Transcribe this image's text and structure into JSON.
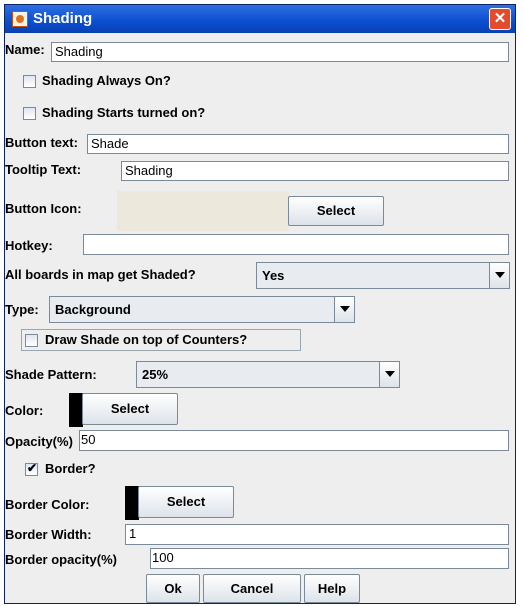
{
  "window": {
    "title": "Shading",
    "close_label": "✕"
  },
  "name": {
    "label": "Name:",
    "value": "Shading"
  },
  "shading_always_on": {
    "label": "Shading Always On?",
    "checked": false
  },
  "shading_starts_on": {
    "label": "Shading Starts turned on?",
    "checked": false
  },
  "button_text": {
    "label": "Button text:",
    "value": "Shade"
  },
  "tooltip_text": {
    "label": "Tooltip Text:",
    "value": "Shading"
  },
  "button_icon": {
    "label": "Button Icon:",
    "select_label": "Select",
    "preview_color": "#ece8dc"
  },
  "hotkey": {
    "label": "Hotkey:",
    "value": ""
  },
  "all_boards": {
    "label": "All boards in map get Shaded?",
    "selected": "Yes"
  },
  "type": {
    "label": "Type:",
    "selected": "Background"
  },
  "draw_shade_on_top": {
    "label": "Draw Shade on top of Counters?",
    "checked": false
  },
  "shade_pattern": {
    "label": "Shade Pattern:",
    "selected": "25%"
  },
  "color": {
    "label": "Color:",
    "select_label": "Select",
    "value": "#000000"
  },
  "opacity": {
    "label": "Opacity(%)",
    "value": "50"
  },
  "border": {
    "label": "Border?",
    "checked": true,
    "check_glyph": "✔"
  },
  "border_color": {
    "label": "Border Color:",
    "select_label": "Select",
    "value": "#000000"
  },
  "border_width": {
    "label": "Border Width:",
    "value": "1"
  },
  "border_opacity": {
    "label": "Border opacity(%)",
    "value": "100"
  },
  "footer": {
    "ok_label": "Ok",
    "cancel_label": "Cancel",
    "help_label": "Help"
  }
}
